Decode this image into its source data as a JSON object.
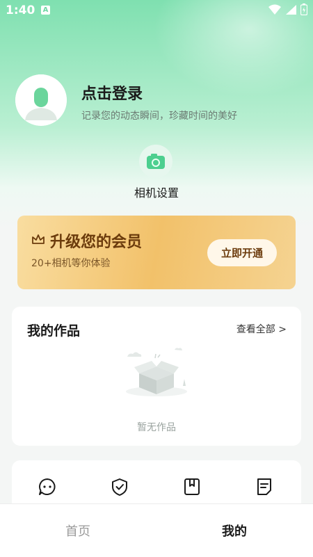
{
  "status_bar": {
    "time": "1:40",
    "notification_badge": "A",
    "icons": [
      "wifi-icon",
      "signal-icon",
      "battery-icon"
    ]
  },
  "profile": {
    "title": "点击登录",
    "subtitle": "记录您的动态瞬间，珍藏时间的美好",
    "avatar_icon": "user-icon"
  },
  "camera_settings": {
    "label": "相机设置",
    "icon": "camera-icon"
  },
  "vip": {
    "title": "升级您的会员",
    "subtitle": "20+相机等你体验",
    "button": "立即开通",
    "icon": "crown-icon"
  },
  "works": {
    "title": "我的作品",
    "view_all": "查看全部 >",
    "empty_text": "暂无作品"
  },
  "tools": {
    "icons": [
      "chat-icon",
      "shield-check-icon",
      "bookmark-icon",
      "document-icon"
    ]
  },
  "bottom_nav": {
    "items": [
      {
        "label": "首页",
        "active": false
      },
      {
        "label": "我的",
        "active": true
      }
    ]
  },
  "colors": {
    "brand_green": "#7fe0b0",
    "accent_green": "#4ccf8f",
    "vip_gold": "#f2c16a",
    "vip_text": "#6b3b0c"
  }
}
